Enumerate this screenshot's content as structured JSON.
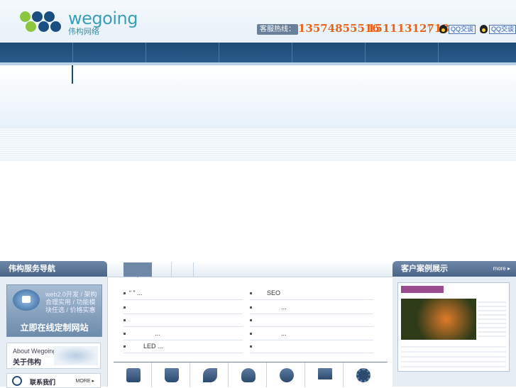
{
  "brand": {
    "name": "wegoing",
    "subtitle": "伟构网络",
    "dot_colors": [
      "#8cc63f",
      "#1b4f82",
      "#1b4f82",
      "#1b4f82"
    ]
  },
  "header": {
    "hotline_label": "客服热线：",
    "hotline_1": "13574855516",
    "hotline_2": "15111312718",
    "separator": "|",
    "qq_buttons": [
      "QQ交谈",
      "QQ交谈"
    ]
  },
  "nav": {
    "item_count": 7
  },
  "left_panel": {
    "title": "伟构服务导航",
    "cta_small": "web2.0开发 / 架构合理实用 / 功能模块任选 / 价格实惠",
    "cta_big": "立即在线定制网站",
    "about_en": "About Wegoing",
    "about_cn": "关于伟构",
    "contact_label": "联系我们",
    "contact_more": "MORE ▸"
  },
  "right_panel": {
    "title": "客户案例展示",
    "more": "more ▸"
  },
  "news": {
    "left": [
      "“   ”   ...",
      "",
      "",
      "...",
      "LED   ..."
    ],
    "right": [
      "SEO",
      "...",
      "",
      "...",
      ""
    ]
  },
  "services": [
    "photo-icon",
    "music-icon",
    "satellite-icon",
    "head-icon",
    "globe-icon",
    "monitor-icon",
    "gear-icon"
  ],
  "colors": {
    "nav": "#2a5c8c",
    "accent_orange": "#e9641a",
    "panel_title": "#5a7498"
  }
}
